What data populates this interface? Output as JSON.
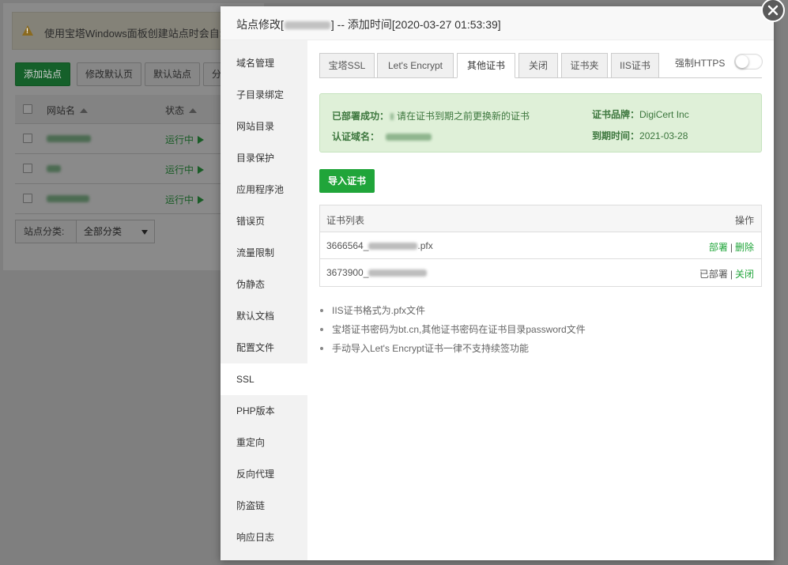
{
  "background": {
    "warning_text": "使用宝塔Windows面板创建站点时会自动",
    "toolbar": [
      {
        "label": "添加站点",
        "primary": true
      },
      {
        "label": "修改默认页",
        "primary": false
      },
      {
        "label": "默认站点",
        "primary": false
      },
      {
        "label": "分",
        "primary": false
      }
    ],
    "table_headers": {
      "name": "网站名",
      "status": "状态"
    },
    "rows": [
      {
        "status": "运行中"
      },
      {
        "status": "运行中"
      },
      {
        "status": "运行中"
      }
    ],
    "filter_label": "站点分类:",
    "filter_value": "全部分类"
  },
  "modal": {
    "title_prefix": "站点修改[",
    "title_suffix": "] -- 添加时间[2020-03-27 01:53:39]",
    "sidebar": [
      {
        "label": "域名管理"
      },
      {
        "label": "子目录绑定"
      },
      {
        "label": "网站目录"
      },
      {
        "label": "目录保护"
      },
      {
        "label": "应用程序池"
      },
      {
        "label": "错误页"
      },
      {
        "label": "流量限制"
      },
      {
        "label": "伪静态"
      },
      {
        "label": "默认文档"
      },
      {
        "label": "配置文件"
      },
      {
        "label": "SSL"
      },
      {
        "label": "PHP版本"
      },
      {
        "label": "重定向"
      },
      {
        "label": "反向代理"
      },
      {
        "label": "防盗链"
      },
      {
        "label": "响应日志"
      }
    ],
    "active_sidebar": "SSL",
    "tabs": [
      {
        "label": "宝塔SSL"
      },
      {
        "label": "Let's Encrypt"
      },
      {
        "label": "其他证书"
      },
      {
        "label": "关闭"
      },
      {
        "label": "证书夹"
      },
      {
        "label": "IIS证书"
      }
    ],
    "active_tab": "其他证书",
    "force_https_label": "强制HTTPS",
    "force_https_enabled": false,
    "status": {
      "deployed_label": "已部署成功：",
      "deployed_message": "请在证书到期之前更换新的证书",
      "domain_label": "认证域名：",
      "brand_label": "证书品牌：",
      "brand_value": "DigiCert Inc",
      "expiry_label": "到期时间：",
      "expiry_value": "2021-03-28"
    },
    "import_button": "导入证书",
    "cert_table": {
      "header_left": "证书列表",
      "header_right": "操作",
      "rows": [
        {
          "id_prefix": "3666564_",
          "suffix": ".pfx",
          "action_text": "",
          "deploy_link": "部署",
          "secondary_link": "删除"
        },
        {
          "id_prefix": "3673900_",
          "suffix": "",
          "action_text": "已部署",
          "deploy_link": "",
          "secondary_link": "关闭"
        }
      ],
      "separator": "|"
    },
    "notes": [
      "IIS证书格式为.pfx文件",
      "宝塔证书密码为bt.cn,其他证书密码在证书目录password文件",
      "手动导入Let's Encrypt证书一律不支持续签功能"
    ]
  },
  "colors": {
    "brand_green": "#20a53a",
    "success_bg": "#dff0d8",
    "success_text": "#3c763d",
    "overlay": "#7f7f7f"
  },
  "icons": {
    "close": "close-icon",
    "warning": "warning-icon",
    "sort": "sort-up-icon",
    "play": "play-icon",
    "caret": "caret-down-icon"
  }
}
